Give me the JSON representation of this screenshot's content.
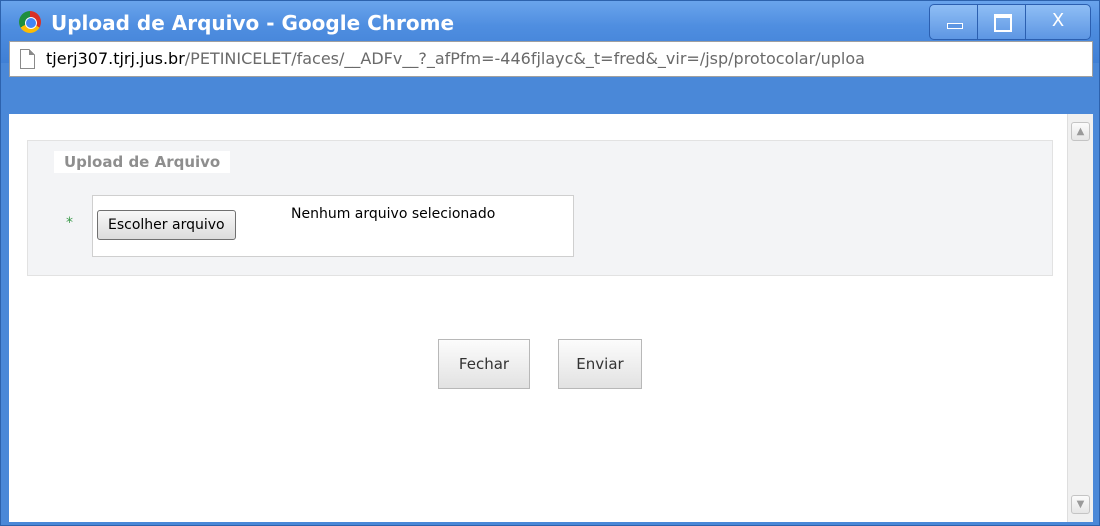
{
  "window": {
    "title": "Upload de Arquivo - Google Chrome",
    "icon": "chrome-icon",
    "controls": {
      "minimize": "minimize-icon",
      "maximize": "maximize-icon",
      "close": "X"
    }
  },
  "addressbar": {
    "host": "tjerj307.tjrj.jus.br",
    "path": "/PETINICELET/faces/__ADFv__?_afPfm=-446fjlayc&_t=fred&_vir=/jsp/protocolar/uploa"
  },
  "form": {
    "legend": "Upload de Arquivo",
    "required_marker": "*",
    "file_button_label": "Escolher arquivo",
    "file_status": "Nenhum arquivo selecionado"
  },
  "actions": {
    "close_label": "Fechar",
    "send_label": "Enviar"
  },
  "colors": {
    "titlebar": "#4f8ee0",
    "required_star": "#3a9a4a",
    "legend_text": "#8e8e8e"
  }
}
